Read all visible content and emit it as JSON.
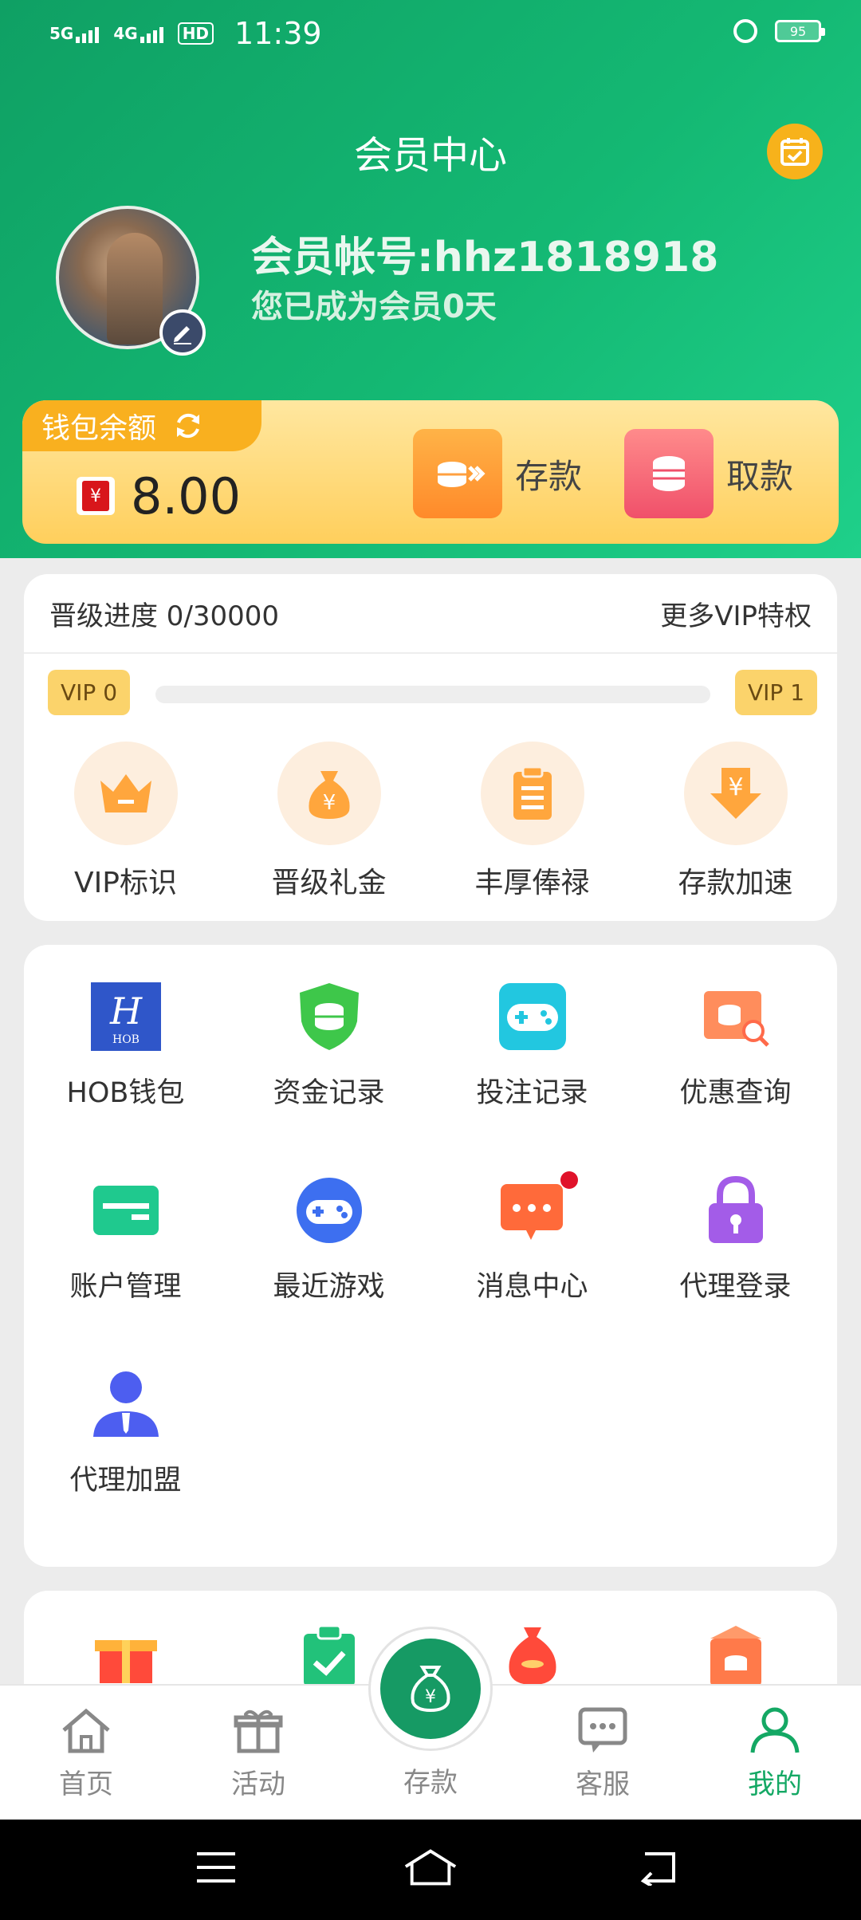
{
  "status_bar": {
    "signal1": "5G",
    "signal2": "4G",
    "hd": "HD",
    "time": "11:39",
    "battery": "95"
  },
  "header": {
    "title": "会员中心"
  },
  "profile": {
    "account_label": "会员帐号:hhz1818918",
    "member_days": "您已成为会员0天"
  },
  "wallet": {
    "label": "钱包余额",
    "currency_symbol": "¥",
    "balance": "8.00",
    "deposit_label": "存款",
    "withdraw_label": "取款"
  },
  "vip": {
    "progress_label": "晋级进度 0/30000",
    "progress_value": 0,
    "more_privileges": "更多VIP特权",
    "current_level": "VIP 0",
    "next_level": "VIP 1",
    "perks": [
      {
        "label": "VIP标识",
        "icon": "crown-icon"
      },
      {
        "label": "晋级礼金",
        "icon": "money-bag-icon"
      },
      {
        "label": "丰厚俸禄",
        "icon": "clipboard-icon"
      },
      {
        "label": "存款加速",
        "icon": "yuan-arrow-down-icon"
      }
    ]
  },
  "menu": {
    "items": [
      {
        "label": "HOB钱包",
        "icon": "hob-logo-icon"
      },
      {
        "label": "资金记录",
        "icon": "shield-coins-icon"
      },
      {
        "label": "投注记录",
        "icon": "gamepad-icon"
      },
      {
        "label": "优惠查询",
        "icon": "coupon-search-icon"
      },
      {
        "label": "账户管理",
        "icon": "card-icon"
      },
      {
        "label": "最近游戏",
        "icon": "gamepad-round-icon"
      },
      {
        "label": "消息中心",
        "icon": "message-icon"
      },
      {
        "label": "代理登录",
        "icon": "lock-icon"
      },
      {
        "label": "代理加盟",
        "icon": "agent-person-icon"
      }
    ],
    "hob_logo_text": "HOB"
  },
  "tabbar": {
    "items": [
      {
        "label": "首页",
        "icon": "home-icon"
      },
      {
        "label": "活动",
        "icon": "gift-icon"
      },
      {
        "label": "存款",
        "icon": "money-bag-icon"
      },
      {
        "label": "客服",
        "icon": "chat-icon"
      },
      {
        "label": "我的",
        "icon": "person-icon"
      }
    ],
    "active": "我的"
  },
  "colors": {
    "brand_green": "#14a864",
    "gold": "#f7b21b",
    "wallet_bg": "#ffd66b"
  }
}
